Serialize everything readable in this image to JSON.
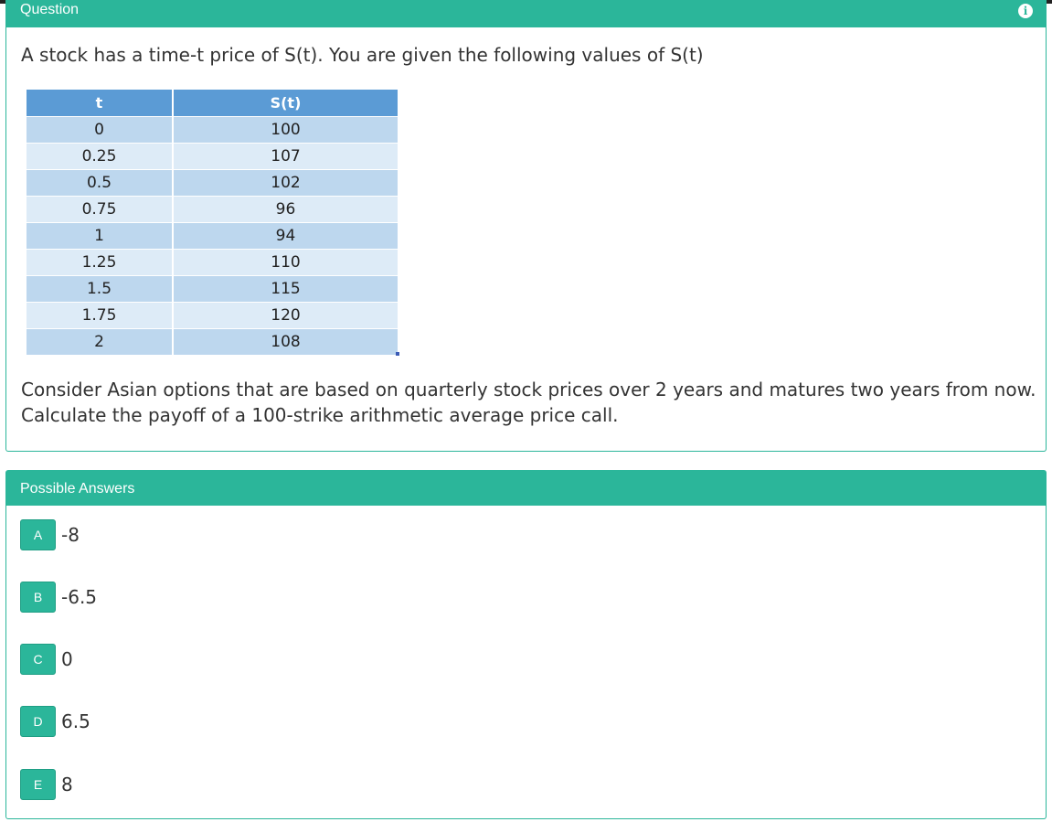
{
  "question": {
    "heading": "Question",
    "intro": "A stock has a time-t price of S(t). You are given the following values of S(t)",
    "table": {
      "headers": [
        "t",
        "S(t)"
      ],
      "rows": [
        [
          "0",
          "100"
        ],
        [
          "0.25",
          "107"
        ],
        [
          "0.5",
          "102"
        ],
        [
          "0.75",
          "96"
        ],
        [
          "1",
          "94"
        ],
        [
          "1.25",
          "110"
        ],
        [
          "1.5",
          "115"
        ],
        [
          "1.75",
          "120"
        ],
        [
          "2",
          "108"
        ]
      ]
    },
    "body_line1": "Consider Asian options that are based on quarterly stock prices over 2 years and matures two years from now.",
    "body_line2": "Calculate the payoff of a 100-strike arithmetic average price call."
  },
  "answers": {
    "heading": "Possible Answers",
    "options": [
      {
        "letter": "A",
        "value": "-8"
      },
      {
        "letter": "B",
        "value": "-6.5"
      },
      {
        "letter": "C",
        "value": "0"
      },
      {
        "letter": "D",
        "value": "6.5"
      },
      {
        "letter": "E",
        "value": "8"
      }
    ]
  },
  "colors": {
    "accent": "#2bb69a",
    "table_header": "#5b9bd5",
    "row_dark": "#bdd7ee",
    "row_light": "#ddebf7"
  }
}
